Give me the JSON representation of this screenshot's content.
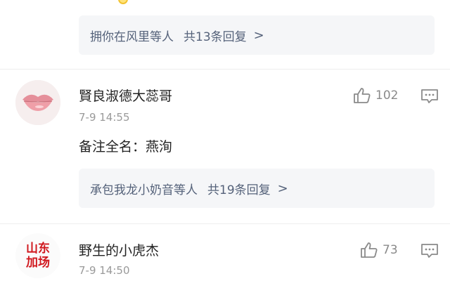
{
  "top_partial": {
    "reply_summary": {
      "users": "拥你在风里等人",
      "count_text": "共13条回复",
      "arrow": ">"
    }
  },
  "comments": [
    {
      "username": "賢良淑德大蕊哥",
      "time": "7-9 14:55",
      "content": "备注全名：燕洵",
      "likes": "102",
      "avatar": "lips-avatar",
      "reply_summary": {
        "users": "承包我龙小奶音等人",
        "count_text": "共19条回复",
        "arrow": ">"
      }
    },
    {
      "username": "野生的小虎杰",
      "time": "7-9 14:50",
      "likes": "73",
      "avatar": {
        "line1": "山东",
        "line2": "加场"
      }
    }
  ],
  "icons": {
    "like": "thumbs-up-icon",
    "reply": "comment-bubble-icon"
  },
  "colors": {
    "link": "#55627a",
    "meta": "#9a9a9a",
    "reply_bg": "#f5f6f8",
    "avatar_text": "#d0181e"
  }
}
